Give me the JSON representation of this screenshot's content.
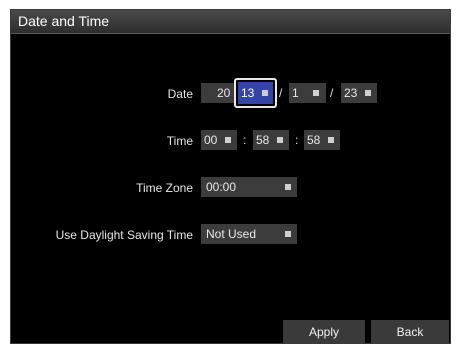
{
  "dialog": {
    "title": "Date and Time",
    "date": {
      "label": "Date",
      "year_prefix": "20",
      "year_suffix": "13",
      "separator": "/",
      "month": "1",
      "day": "23"
    },
    "time": {
      "label": "Time",
      "separator": ":",
      "hour": "00",
      "minute": "58",
      "second": "58"
    },
    "time_zone": {
      "label": "Time Zone",
      "value": "00:00"
    },
    "dst": {
      "label": "Use Daylight Saving Time",
      "value": "Not Used"
    },
    "buttons": {
      "apply": "Apply",
      "back": "Back"
    },
    "colors": {
      "background": "#000000",
      "field": "#3c3c3c",
      "selected": "#3346a8",
      "text": "#e6e6e6"
    }
  }
}
